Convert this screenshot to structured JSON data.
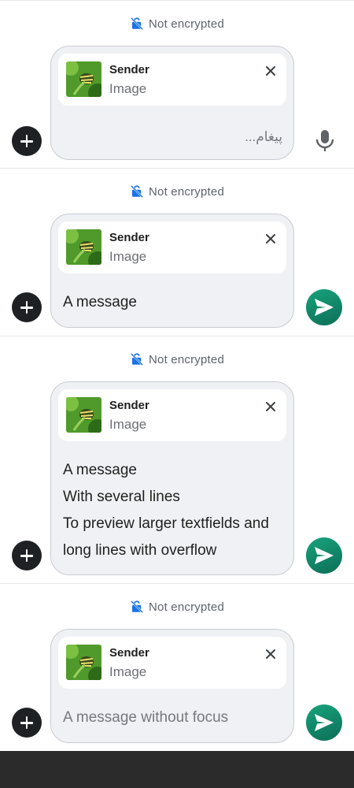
{
  "encryption_label": "Not encrypted",
  "reply_preview": {
    "sender": "Sender",
    "content_type": "Image"
  },
  "variants": [
    {
      "input_value": "",
      "input_placeholder": "پیغام...",
      "trailing_action": "mic-icon"
    },
    {
      "input_value": "A message",
      "trailing_action": "send-icon"
    },
    {
      "input_lines": [
        "A message",
        "With several lines",
        "To preview larger textfields and",
        "long lines with overflow"
      ],
      "trailing_action": "send-icon"
    },
    {
      "input_value": "",
      "input_placeholder": "A message without focus",
      "trailing_action": "send-icon"
    }
  ],
  "icons": {
    "lock": "no-encryption-lock-icon",
    "close": "close-icon",
    "attach": "add-icon",
    "send": "send-icon",
    "mic": "mic-icon"
  },
  "colors": {
    "send_button": "#12896a",
    "lock_icon": "#1a73e8",
    "attach_button": "#1f2023",
    "bubble": "#f0f1f5"
  }
}
